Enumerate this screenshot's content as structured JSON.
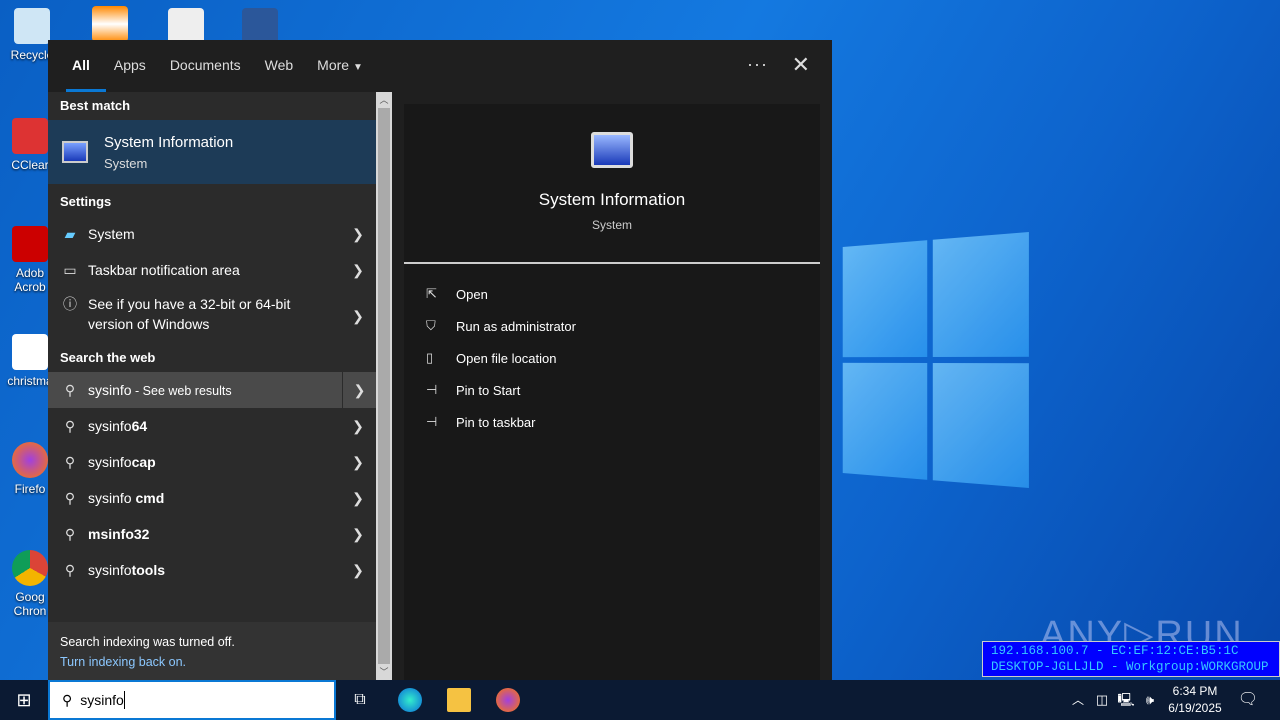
{
  "desktop": {
    "icons": [
      {
        "label": "Recycle"
      },
      {
        "label": "CClear"
      },
      {
        "label": "Adob Acrob"
      },
      {
        "label": "christma"
      },
      {
        "label": "Firefo"
      },
      {
        "label": "Goog Chron"
      }
    ]
  },
  "search": {
    "tabs": [
      "All",
      "Apps",
      "Documents",
      "Web",
      "More"
    ],
    "more_icon": "caret-down",
    "best_match_header": "Best match",
    "best_match": {
      "title": "System Information",
      "subtitle": "System"
    },
    "settings_header": "Settings",
    "settings": [
      {
        "label": "System",
        "icon": "laptop"
      },
      {
        "label": "Taskbar notification area",
        "icon": "taskbar"
      },
      {
        "label": "See if you have a 32-bit or 64-bit version of Windows",
        "icon": "info"
      }
    ],
    "web_header": "Search the web",
    "web": [
      {
        "prefix": "sysinfo",
        "suffix": "",
        "note": " - See web results"
      },
      {
        "prefix": "sysinfo",
        "suffix": "64",
        "note": ""
      },
      {
        "prefix": "sysinfo",
        "suffix": "cap",
        "note": ""
      },
      {
        "prefix": "sysinfo",
        "suffix": " cmd",
        "note": ""
      },
      {
        "prefix": "",
        "suffix": "msinfo32",
        "note": ""
      },
      {
        "prefix": "sysinfo",
        "suffix": "tools",
        "note": ""
      }
    ],
    "footer": {
      "text": "Search indexing was turned off.",
      "link": "Turn indexing back on."
    },
    "preview": {
      "title": "System Information",
      "subtitle": "System",
      "actions": [
        "Open",
        "Run as administrator",
        "Open file location",
        "Pin to Start",
        "Pin to taskbar"
      ]
    },
    "query": "sysinfo"
  },
  "overlay": {
    "line1": "192.168.100.7 - EC:EF:12:CE:B5:1C",
    "line2": "DESKTOP-JGLLJLD - Workgroup:WORKGROUP",
    "watermark": "ANY RUN"
  },
  "clock": {
    "time": "6:34 PM",
    "date": "6/19/2025"
  }
}
